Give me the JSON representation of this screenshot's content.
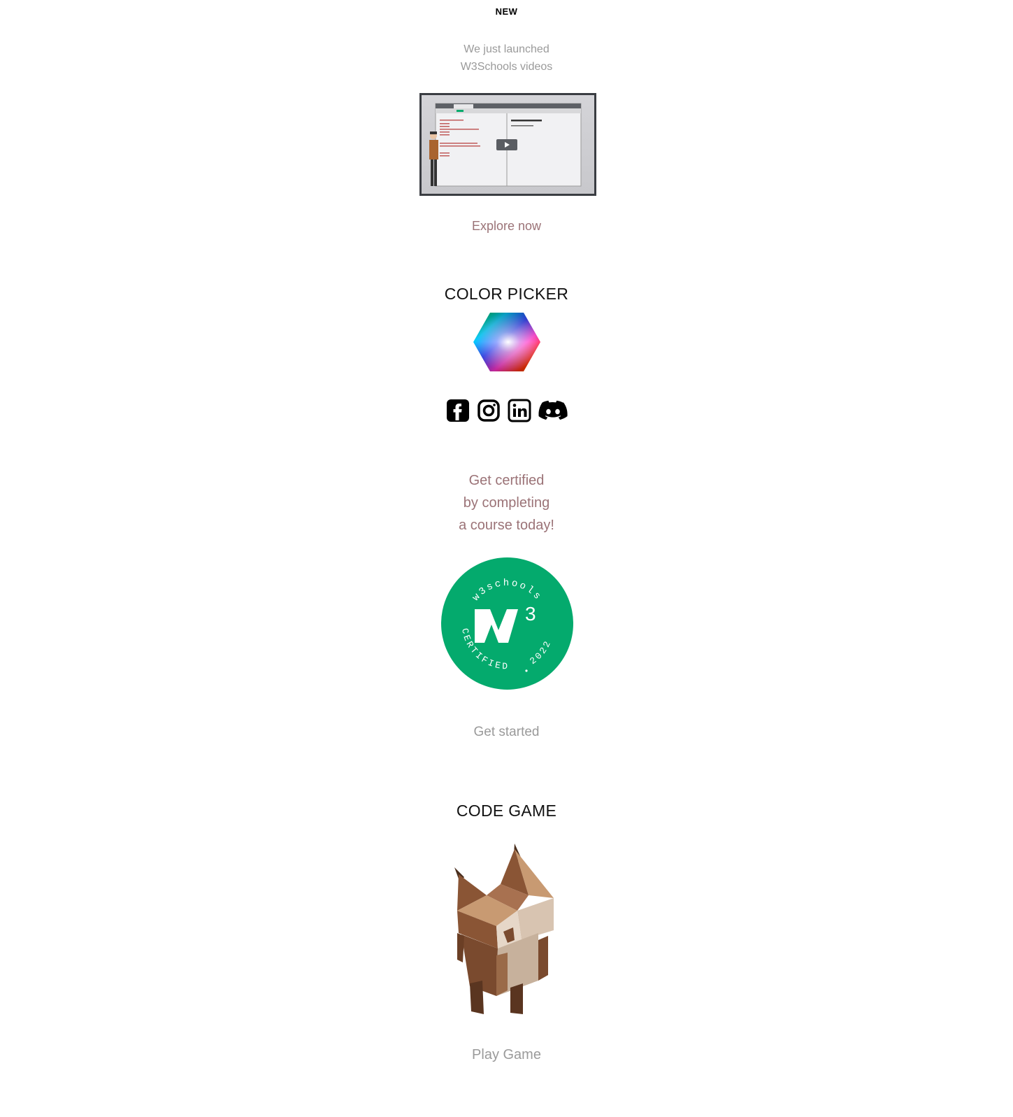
{
  "video_promo": {
    "badge": "NEW",
    "line1": "We just launched",
    "line2": "W3Schools videos",
    "cta": "Explore now",
    "thumb": {
      "tab_title": "Page Title",
      "heading": "My First Heading",
      "paragraph": "My first paragraph."
    }
  },
  "color_picker": {
    "title": "COLOR PICKER",
    "icon": "color-hexagon-icon"
  },
  "social": {
    "icons": [
      "facebook-icon",
      "instagram-icon",
      "linkedin-icon",
      "discord-icon"
    ]
  },
  "certification": {
    "line1": "Get certified",
    "line2": "by completing",
    "line3": "a course today!",
    "badge_top": "w3schools",
    "badge_bottom": "CERTIFIED",
    "badge_year": "2022",
    "badge_color": "#04aa6d",
    "cta": "Get started"
  },
  "code_game": {
    "title": "CODE GAME",
    "cta": "Play Game"
  },
  "colors": {
    "link_muted": "#9b7377",
    "text_gray": "#9a9a9a"
  }
}
